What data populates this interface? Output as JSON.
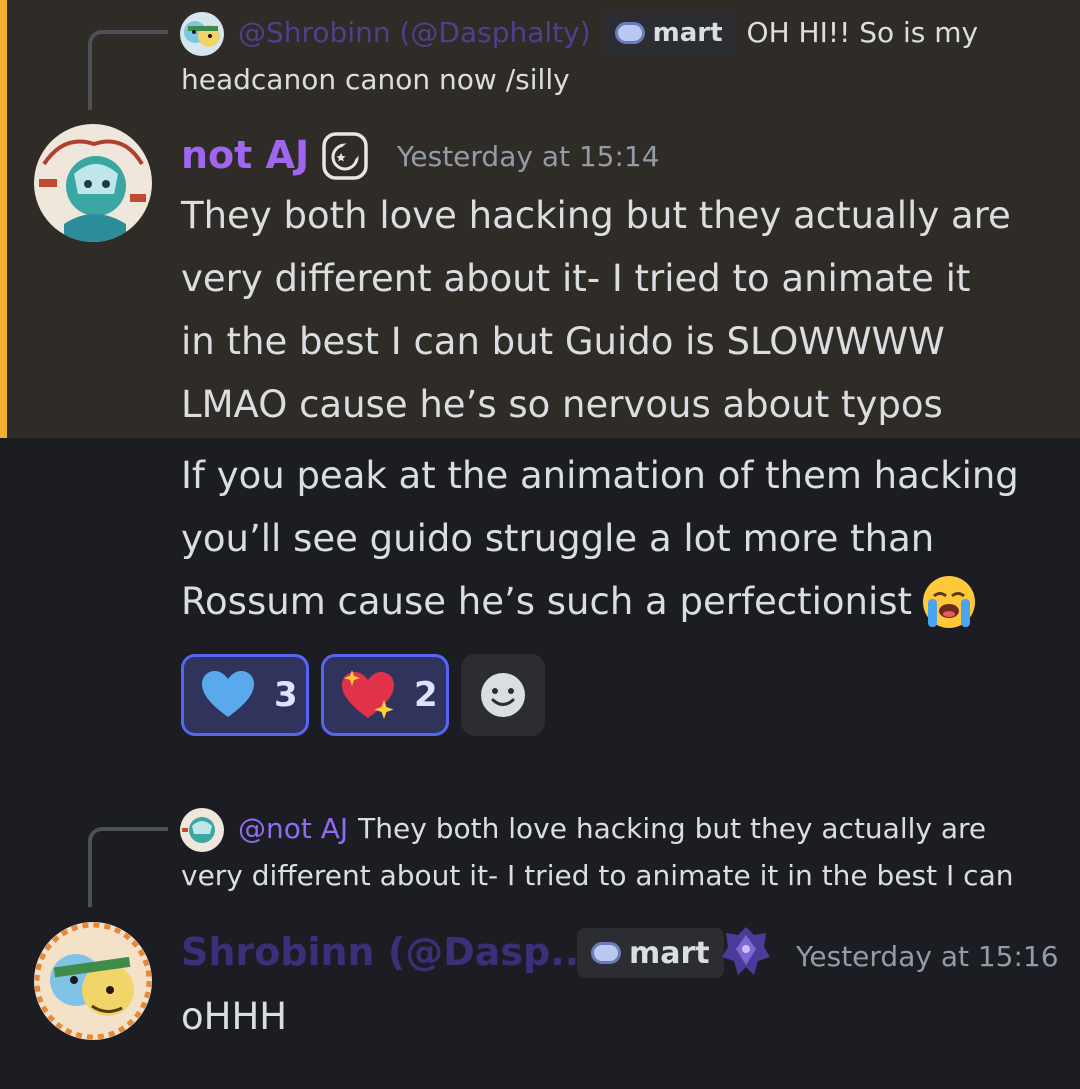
{
  "messages": [
    {
      "reply": {
        "name": "@Shrobinn (@Dasphalty)",
        "tag": "mart",
        "text_line1": "OH HI!! So is my",
        "text_line2": "headcanon canon now /silly"
      },
      "author": "not AJ",
      "timestamp": "Yesterday at 15:14",
      "paragraph1": [
        "They both love hacking but they actually are",
        "very different about it- I tried to animate it",
        "in the best I can but Guido is SLOWWWW",
        "LMAO cause he’s so nervous about typos"
      ],
      "paragraph2": [
        "If you peak at the animation of them hacking",
        "you’ll see guido struggle a lot more than",
        "Rossum cause he’s such a perfectionist"
      ],
      "reactions": [
        {
          "icon": "blue-heart-icon",
          "count": "3"
        },
        {
          "icon": "sparkling-heart-icon",
          "count": "2"
        }
      ]
    },
    {
      "reply": {
        "name": "@not AJ",
        "text_line1": "They both love hacking but they actually are",
        "text_line2": "very different about it- I tried to animate it in the best I can"
      },
      "author": "Shrobinn (@Dasp...",
      "tag": "mart",
      "timestamp": "Yesterday at 15:16",
      "text": "oHHH"
    }
  ],
  "colors": {
    "mention_bg": "#2f2c27",
    "mention_bar": "#f0b132",
    "author1": "#a066f0",
    "author2": "#3b2f7a",
    "reaction_bg": "#30335c",
    "reaction_border": "#5865f2"
  }
}
